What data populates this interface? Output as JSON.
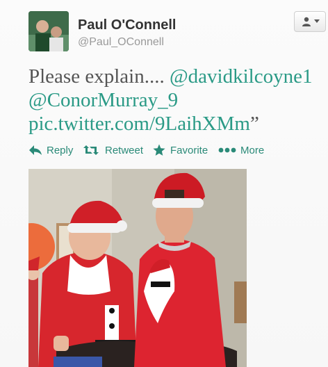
{
  "author": {
    "name": "Paul O'Connell",
    "handle": "@Paul_OConnell"
  },
  "tweet": {
    "text_prefix": "Please explain.... ",
    "mention1": "@davidkilcoyne1",
    "mention2": "@ConorMurray_9",
    "pic_link": "pic.twitter.com/9LaihXMm",
    "text_suffix": "”"
  },
  "actions": {
    "reply": "Reply",
    "retweet": "Retweet",
    "favorite": "Favorite",
    "more": "More"
  },
  "colors": {
    "link": "#2a9a86",
    "action": "#2a8a78",
    "name": "#333333",
    "handle": "#999999"
  },
  "icons": [
    "user-icon",
    "caret-down-icon",
    "reply-icon",
    "retweet-icon",
    "star-icon",
    "more-dots-icon"
  ]
}
